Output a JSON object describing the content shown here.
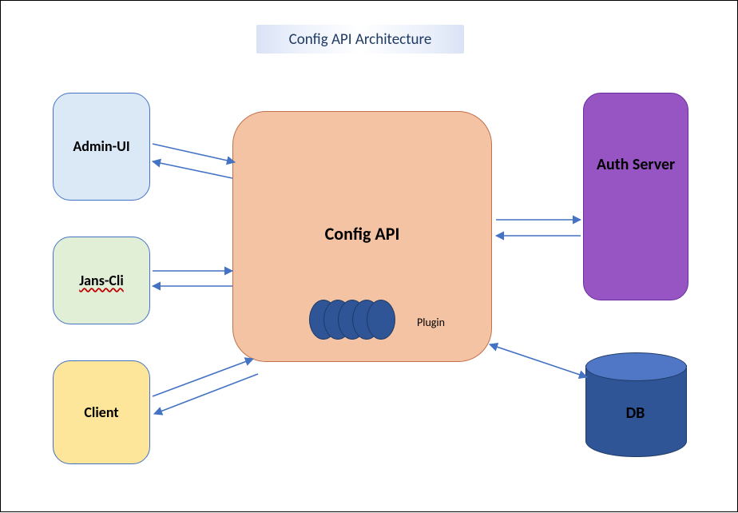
{
  "title": "Config API Architecture",
  "boxes": {
    "admin_ui": "Admin-UI",
    "jans_cli": "Jans-Cli",
    "client": "Client",
    "config_api": "Config API",
    "plugin": "Plugin",
    "auth_server": "Auth Server",
    "db": "DB"
  },
  "colors": {
    "arrow": "#4472c4",
    "admin_ui_bg": "#dbe9f6",
    "jans_cli_bg": "#e2efd7",
    "client_bg": "#fde599",
    "config_api_bg": "#f4c3a3",
    "auth_server_bg": "#9754c3",
    "db_bg": "#2f5597"
  },
  "chart_data": {
    "type": "diagram",
    "nodes": [
      {
        "id": "admin_ui",
        "label": "Admin-UI",
        "kind": "client"
      },
      {
        "id": "jans_cli",
        "label": "Jans-Cli",
        "kind": "client"
      },
      {
        "id": "client",
        "label": "Client",
        "kind": "client"
      },
      {
        "id": "config_api",
        "label": "Config API",
        "kind": "service",
        "plugin_count": 5,
        "plugin_label": "Plugin"
      },
      {
        "id": "auth_server",
        "label": "Auth Server",
        "kind": "service"
      },
      {
        "id": "db",
        "label": "DB",
        "kind": "datastore"
      }
    ],
    "edges": [
      {
        "from": "admin_ui",
        "to": "config_api",
        "bidirectional": true
      },
      {
        "from": "jans_cli",
        "to": "config_api",
        "bidirectional": true
      },
      {
        "from": "client",
        "to": "config_api",
        "bidirectional": true
      },
      {
        "from": "config_api",
        "to": "auth_server",
        "bidirectional": true
      },
      {
        "from": "config_api",
        "to": "db",
        "bidirectional": true
      }
    ]
  }
}
